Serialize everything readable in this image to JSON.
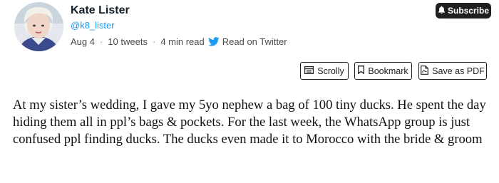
{
  "header": {
    "author_name": "Kate Lister",
    "handle": "@k8_lister",
    "date": "Aug 4",
    "tweet_count": "10 tweets",
    "read_time": "4 min read",
    "read_on_twitter": "Read on Twitter",
    "subscribe_label": "Subscribe"
  },
  "toolbar": {
    "scrolly_label": "Scrolly",
    "bookmark_label": "Bookmark",
    "pdf_label": "Save as PDF"
  },
  "tweet": {
    "text": "At my sister’s wedding, I gave my 5yo nephew a bag of 100 tiny ducks. He spent the day hiding them all in ppl’s bags & pockets. For the last week, the WhatsApp group is just confused ppl finding ducks. The ducks even made it to Morocco with the bride & groom"
  },
  "colors": {
    "link": "#1d9bf0",
    "subscribe_bg": "#1f1f1f",
    "text": "#111111"
  },
  "icons": [
    "avatar",
    "twitter-bird-icon",
    "bell-icon",
    "scrolly-icon",
    "bookmark-icon",
    "pdf-icon"
  ]
}
